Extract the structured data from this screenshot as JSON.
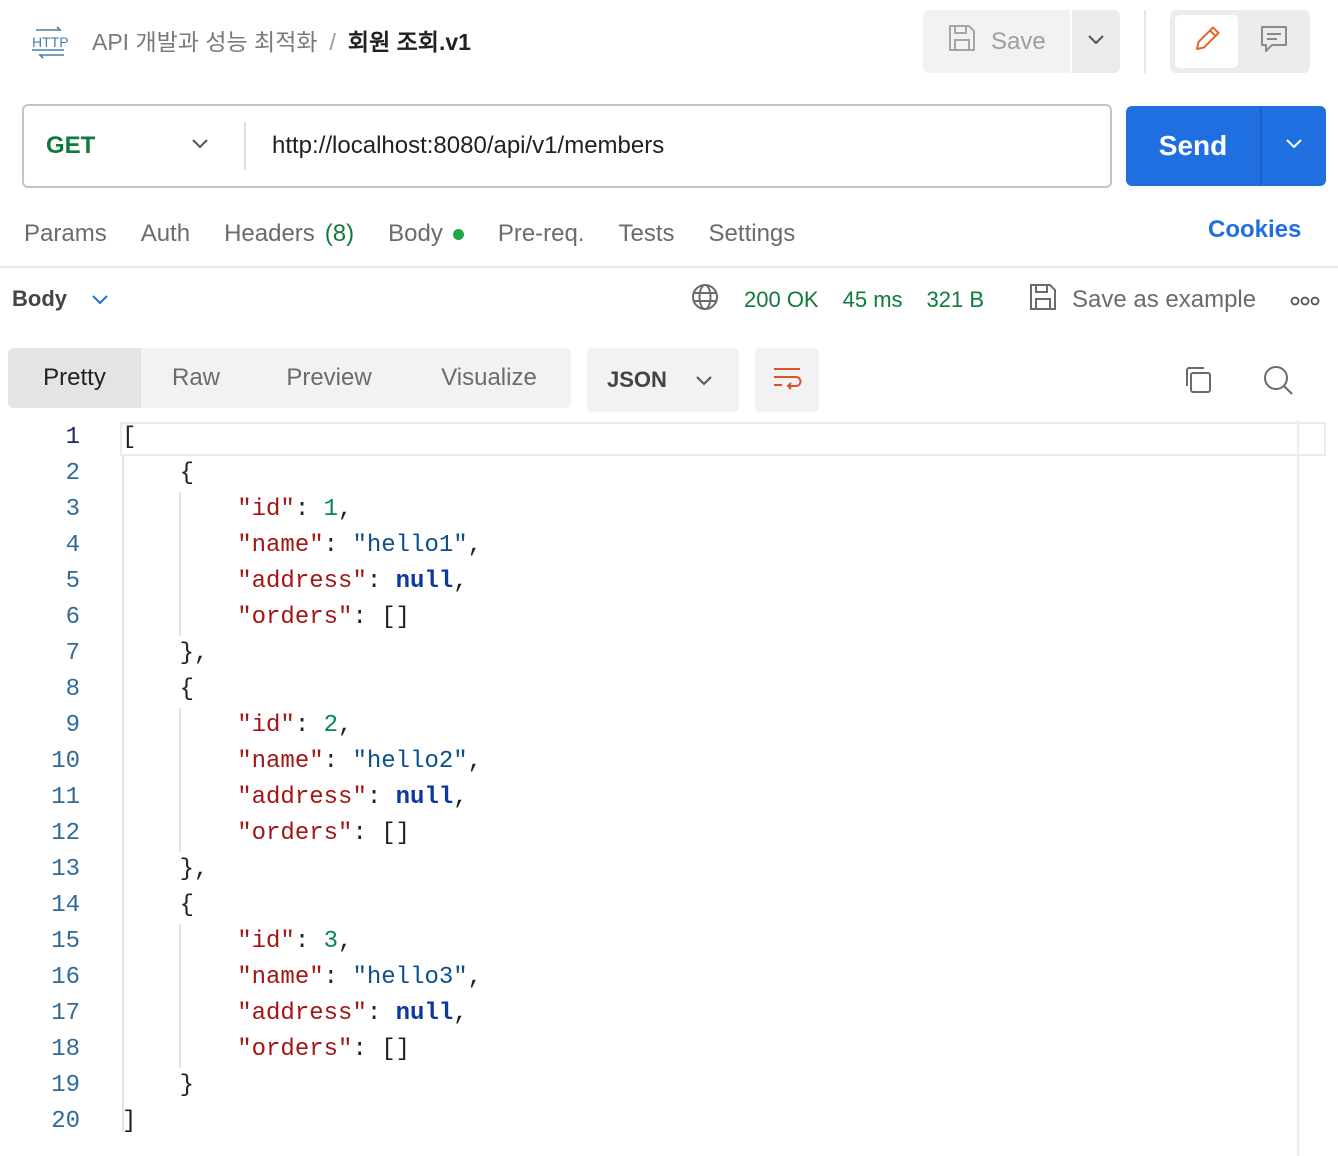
{
  "header": {
    "breadcrumb_parent": "API 개발과 성능 최적화",
    "breadcrumb_separator": "/",
    "breadcrumb_current": "회원 조회.v1",
    "http_badge": "HTTP",
    "save_label": "Save"
  },
  "request": {
    "method": "GET",
    "url": "http://localhost:8080/api/v1/members",
    "send_label": "Send"
  },
  "request_tabs": {
    "params": "Params",
    "auth": "Auth",
    "headers": "Headers",
    "headers_count": "(8)",
    "body": "Body",
    "prereq": "Pre-req.",
    "tests": "Tests",
    "settings": "Settings",
    "cookies": "Cookies"
  },
  "response": {
    "section_label": "Body",
    "status": "200 OK",
    "time": "45 ms",
    "size": "321 B",
    "save_example_label": "Save as example"
  },
  "view": {
    "tabs": [
      "Pretty",
      "Raw",
      "Preview",
      "Visualize"
    ],
    "active_tab": "Pretty",
    "format": "JSON"
  },
  "colors": {
    "send_button": "#1f6fe0",
    "status_green": "#0f7a3a",
    "json_key": "#a31515",
    "json_number": "#098658",
    "json_string": "#0b4f8f",
    "json_null": "#0b3a9e",
    "edit_icon": "#e2672a"
  },
  "icons": {
    "http": "http-icon",
    "save": "floppy-disk-icon",
    "edit": "pencil-icon",
    "comments": "comment-icon",
    "network": "globe-icon",
    "more": "ellipsis-icon",
    "wrap": "wrap-lines-icon",
    "copy": "copy-icon",
    "search": "search-icon"
  },
  "code": {
    "lines": [
      [
        {
          "t": "p",
          "v": "["
        }
      ],
      [
        {
          "t": "p",
          "v": "    {"
        }
      ],
      [
        {
          "t": "p",
          "v": "        "
        },
        {
          "t": "k",
          "v": "\"id\""
        },
        {
          "t": "p",
          "v": ": "
        },
        {
          "t": "n",
          "v": "1"
        },
        {
          "t": "p",
          "v": ","
        }
      ],
      [
        {
          "t": "p",
          "v": "        "
        },
        {
          "t": "k",
          "v": "\"name\""
        },
        {
          "t": "p",
          "v": ": "
        },
        {
          "t": "s",
          "v": "\"hello1\""
        },
        {
          "t": "p",
          "v": ","
        }
      ],
      [
        {
          "t": "p",
          "v": "        "
        },
        {
          "t": "k",
          "v": "\"address\""
        },
        {
          "t": "p",
          "v": ": "
        },
        {
          "t": "z",
          "v": "null"
        },
        {
          "t": "p",
          "v": ","
        }
      ],
      [
        {
          "t": "p",
          "v": "        "
        },
        {
          "t": "k",
          "v": "\"orders\""
        },
        {
          "t": "p",
          "v": ": []"
        }
      ],
      [
        {
          "t": "p",
          "v": "    },"
        }
      ],
      [
        {
          "t": "p",
          "v": "    {"
        }
      ],
      [
        {
          "t": "p",
          "v": "        "
        },
        {
          "t": "k",
          "v": "\"id\""
        },
        {
          "t": "p",
          "v": ": "
        },
        {
          "t": "n",
          "v": "2"
        },
        {
          "t": "p",
          "v": ","
        }
      ],
      [
        {
          "t": "p",
          "v": "        "
        },
        {
          "t": "k",
          "v": "\"name\""
        },
        {
          "t": "p",
          "v": ": "
        },
        {
          "t": "s",
          "v": "\"hello2\""
        },
        {
          "t": "p",
          "v": ","
        }
      ],
      [
        {
          "t": "p",
          "v": "        "
        },
        {
          "t": "k",
          "v": "\"address\""
        },
        {
          "t": "p",
          "v": ": "
        },
        {
          "t": "z",
          "v": "null"
        },
        {
          "t": "p",
          "v": ","
        }
      ],
      [
        {
          "t": "p",
          "v": "        "
        },
        {
          "t": "k",
          "v": "\"orders\""
        },
        {
          "t": "p",
          "v": ": []"
        }
      ],
      [
        {
          "t": "p",
          "v": "    },"
        }
      ],
      [
        {
          "t": "p",
          "v": "    {"
        }
      ],
      [
        {
          "t": "p",
          "v": "        "
        },
        {
          "t": "k",
          "v": "\"id\""
        },
        {
          "t": "p",
          "v": ": "
        },
        {
          "t": "n",
          "v": "3"
        },
        {
          "t": "p",
          "v": ","
        }
      ],
      [
        {
          "t": "p",
          "v": "        "
        },
        {
          "t": "k",
          "v": "\"name\""
        },
        {
          "t": "p",
          "v": ": "
        },
        {
          "t": "s",
          "v": "\"hello3\""
        },
        {
          "t": "p",
          "v": ","
        }
      ],
      [
        {
          "t": "p",
          "v": "        "
        },
        {
          "t": "k",
          "v": "\"address\""
        },
        {
          "t": "p",
          "v": ": "
        },
        {
          "t": "z",
          "v": "null"
        },
        {
          "t": "p",
          "v": ","
        }
      ],
      [
        {
          "t": "p",
          "v": "        "
        },
        {
          "t": "k",
          "v": "\"orders\""
        },
        {
          "t": "p",
          "v": ": []"
        }
      ],
      [
        {
          "t": "p",
          "v": "    }"
        }
      ],
      [
        {
          "t": "p",
          "v": "]"
        }
      ]
    ]
  }
}
